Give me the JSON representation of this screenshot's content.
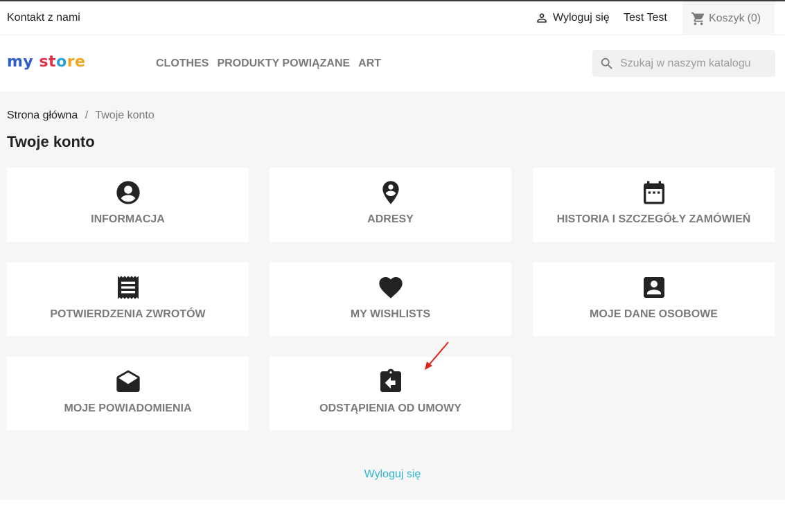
{
  "topbar": {
    "contact_label": "Kontakt z nami",
    "logout_label": "Wyloguj się",
    "user_name": "Test Test",
    "cart_label": "Koszyk",
    "cart_count": "(0)"
  },
  "header": {
    "logo_text_a": "my",
    "logo_text_b": "st",
    "logo_text_c": "o",
    "logo_text_d": "re",
    "nav": [
      "CLOTHES",
      "PRODUKTY POWIĄZANE",
      "ART"
    ],
    "search_placeholder": "Szukaj w naszym katalogu"
  },
  "breadcrumb": {
    "home": "Strona główna",
    "separator": "/",
    "current": "Twoje konto"
  },
  "page_title": "Twoje konto",
  "cards": [
    {
      "label": "INFORMACJA",
      "icon": "account-circle-icon"
    },
    {
      "label": "ADRESY",
      "icon": "location-pin-icon"
    },
    {
      "label": "HISTORIA I SZCZEGÓŁY ZAMÓWIEŃ",
      "icon": "calendar-icon"
    },
    {
      "label": "POTWIERDZENIA ZWROTÓW",
      "icon": "receipt-icon"
    },
    {
      "label": "MY WISHLISTS",
      "icon": "heart-icon"
    },
    {
      "label": "MOJE DANE OSOBOWE",
      "icon": "account-box-icon"
    },
    {
      "label": "MOJE POWIADOMIENIA",
      "icon": "drafts-icon"
    },
    {
      "label": "ODSTĄPIENIA OD UMOWY",
      "icon": "assignment-return-icon"
    }
  ],
  "logout_bottom": "Wyloguj się",
  "colors": {
    "accent": "#2fb5d2",
    "annotation_arrow": "#e2231a",
    "label_gray": "#7a7a7a",
    "background": "#f6f6f6"
  }
}
